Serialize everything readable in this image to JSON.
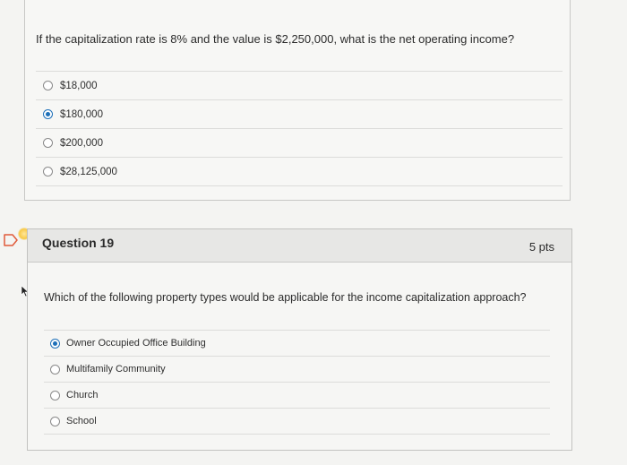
{
  "question18": {
    "text": "If the capitalization rate is 8% and the value is $2,250,000, what is the net operating income?",
    "answers": [
      {
        "label": "$18,000",
        "selected": false
      },
      {
        "label": "$180,000",
        "selected": true
      },
      {
        "label": "$200,000",
        "selected": false
      },
      {
        "label": "$28,125,000",
        "selected": false
      }
    ]
  },
  "question19": {
    "title": "Question 19",
    "points": "5 pts",
    "text": "Which of the following property types would be applicable for the income capitalization approach?",
    "answers": [
      {
        "label": "Owner Occupied Office Building",
        "selected": true
      },
      {
        "label": "Multifamily Community",
        "selected": false
      },
      {
        "label": "Church",
        "selected": false
      },
      {
        "label": "School",
        "selected": false
      }
    ]
  },
  "icons": {
    "flag": "flag-icon",
    "marker": "marker-dot",
    "cursor": "cursor-icon"
  },
  "colors": {
    "accent": "#1d6fb8",
    "flag_outline": "#e05a3a",
    "marker": "#f7c948"
  }
}
